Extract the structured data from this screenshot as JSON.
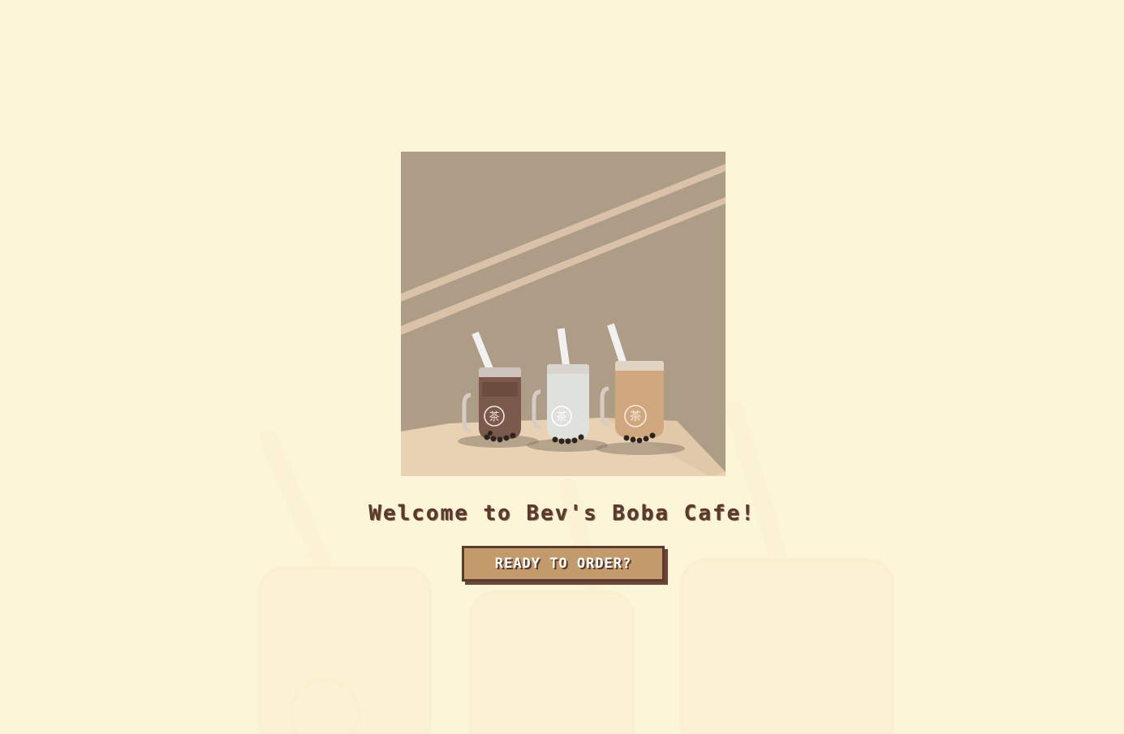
{
  "welcome": {
    "title": "Welcome to Bev's Boba Cafe!",
    "button_label": "READY TO ORDER?"
  },
  "hero": {
    "drinks": [
      "chocolate-boba-drink",
      "milk-boba-drink",
      "milk-tea-boba-drink"
    ],
    "cup_logo": "茶"
  },
  "colors": {
    "background": "#fdf5d8",
    "title": "#5a3a2c",
    "button_fill": "#c39a6c",
    "button_border": "#5a3a2c",
    "wall": "#ad9d87",
    "floor": "#e9d2b3"
  }
}
